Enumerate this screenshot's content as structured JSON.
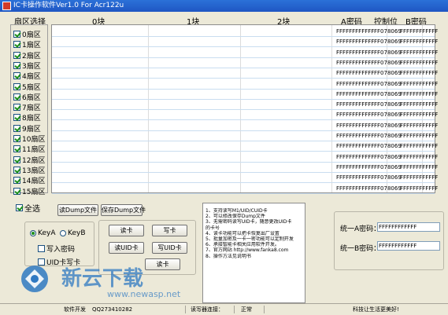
{
  "window": {
    "title": "IC卡操作软件Ver1.0 For Acr122u"
  },
  "header": {
    "sector_select": "扇区选择",
    "block0": "0块",
    "block1": "1块",
    "block2": "2块",
    "key_a": "A密码",
    "control": "控制位",
    "key_b": "B密码"
  },
  "sectors": [
    "0扇区",
    "1扇区",
    "2扇区",
    "3扇区",
    "4扇区",
    "5扇区",
    "6扇区",
    "7扇区",
    "8扇区",
    "9扇区",
    "10扇区",
    "11扇区",
    "12扇区",
    "13扇区",
    "14扇区",
    "15扇区"
  ],
  "grid": {
    "key_a_value": "FFFFFFFFFFFF",
    "control_value": "FF078069",
    "key_b_value": "FFFFFFFFFFFF"
  },
  "controls": {
    "select_all": "全选",
    "read_dump": "读Dump文件",
    "save_dump": "保存Dump文件",
    "key_a_radio": "KeyA",
    "key_b_radio": "KeyB",
    "write_password": "写入密码",
    "uid_write": "UID卡写卡",
    "read_card": "读卡",
    "write_card": "写卡",
    "read_uid": "读UID卡",
    "write_uid": "写UID卡",
    "read_btn": "读卡"
  },
  "info": {
    "lines": [
      "1、支持读写M1/UID/CUID卡",
      "2、可以修改保存Dump文件",
      "3、无需密码读写UID卡，随意更改UID卡",
      "   的卡号",
      "4、读卡功能可以把卡恢复出厂设置",
      "5、批量加密及一卡一密功能可以定制开发",
      "6、承接智能卡相关应用软件开发。",
      "7、官方网站 http://www.fanka8.com",
      "8、操作方法见说明书"
    ]
  },
  "password": {
    "label_a": "统一A密码：",
    "label_b": "统一B密码：",
    "value_a": "FFFFFFFFFFFF",
    "value_b": "FFFFFFFFFFFF"
  },
  "status": {
    "dev_label": "软件开发",
    "dev_qq": "QQ273410282",
    "reader_label": "读写器连接：",
    "reader_state": "正常",
    "slogan": "科技让生活更美好!"
  },
  "watermark": {
    "brand": "新云下载",
    "url": "www.newasp.net"
  },
  "colors": {
    "title_bar": "#2b71d8",
    "check_green": "#1a8f1a",
    "grid_line": "#c9ddf0",
    "watermark_blue": "#2f79c2"
  }
}
